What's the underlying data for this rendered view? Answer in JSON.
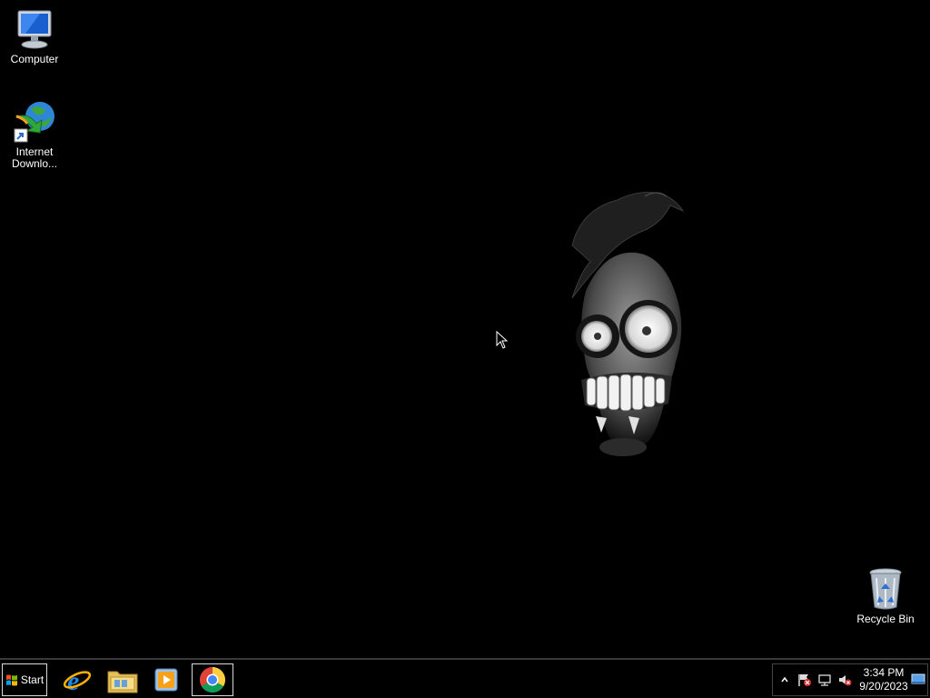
{
  "desktop": {
    "icons": [
      {
        "label": "Computer",
        "icon": "computer-icon"
      },
      {
        "label": "Internet Downlo...",
        "icon": "internet-download-manager-icon"
      },
      {
        "label": "Recycle Bin",
        "icon": "recycle-bin-icon"
      }
    ],
    "wallpaper": "dark-skull-with-crow"
  },
  "taskbar": {
    "start_label": "Start",
    "pinned": [
      {
        "name": "Internet Explorer",
        "icon": "internet-explorer-icon"
      },
      {
        "name": "Windows Explorer",
        "icon": "folder-icon"
      },
      {
        "name": "Windows Media Player",
        "icon": "media-player-icon"
      },
      {
        "name": "Google Chrome",
        "icon": "chrome-icon",
        "active": true
      }
    ],
    "tray": {
      "icons": [
        "show-hidden-icons-icon",
        "action-center-icon",
        "network-icon",
        "volume-muted-icon"
      ],
      "time": "3:34 PM",
      "date": "9/20/2023"
    }
  },
  "colors": {
    "background": "#000000",
    "taskbar": "#000000",
    "text": "#ffffff"
  }
}
